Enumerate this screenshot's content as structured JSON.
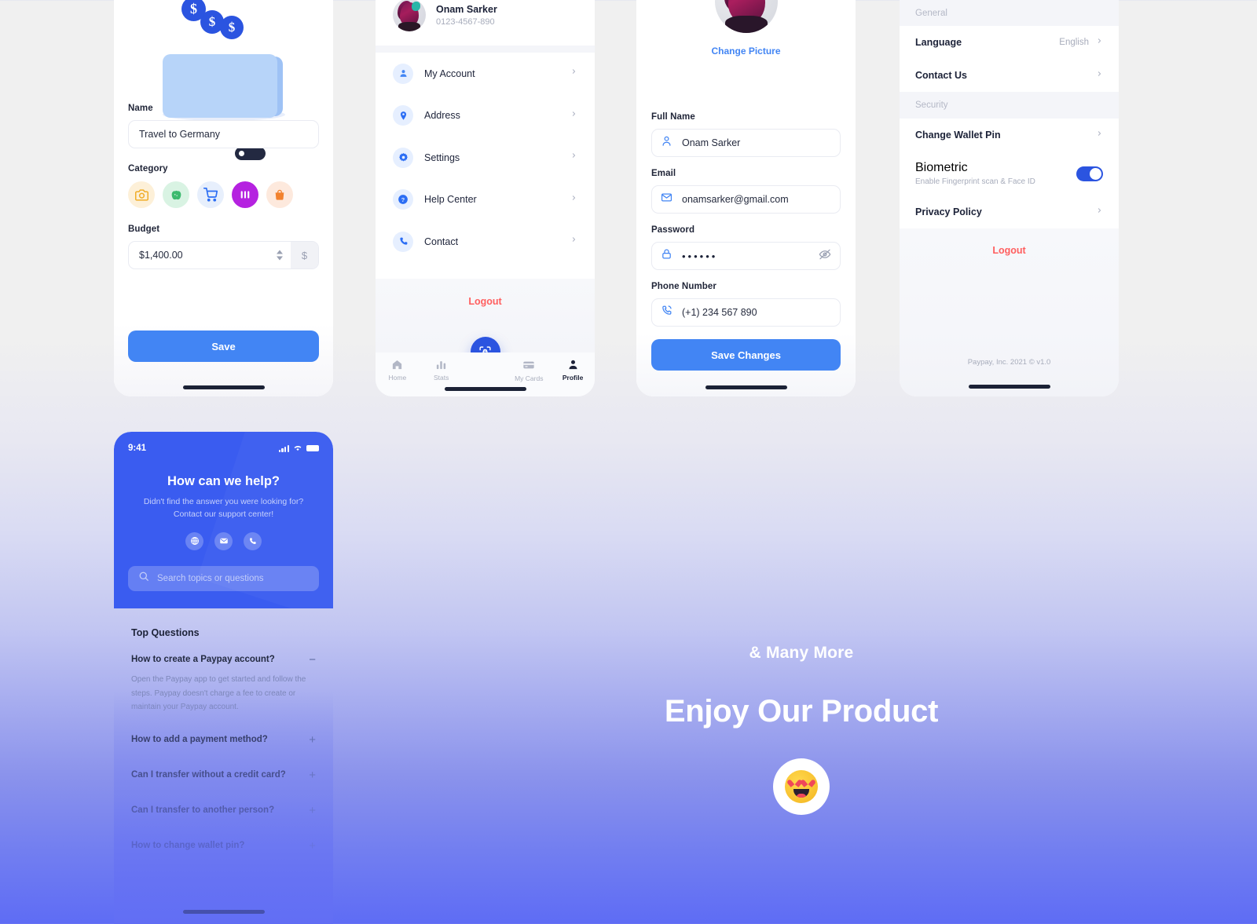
{
  "screens": {
    "add_budget": {
      "fields": {
        "name_label": "Name",
        "name_value": "Travel to Germany",
        "category_label": "Category",
        "budget_label": "Budget",
        "budget_value": "$1,400.00",
        "currency_symbol": "$"
      },
      "categories": [
        {
          "name": "camera-icon",
          "color": "#FDF0D8"
        },
        {
          "name": "food-icon",
          "color": "#D9F3E3"
        },
        {
          "name": "cart-icon",
          "color": "#E7EFFC"
        },
        {
          "name": "music-icon",
          "color": "#B522E0"
        },
        {
          "name": "bag-icon",
          "color": "#FDE9DD"
        }
      ],
      "save_label": "Save"
    },
    "profile_menu": {
      "user_name": "Onam Sarker",
      "user_phone": "0123-4567-890",
      "items": [
        {
          "label": "My Account",
          "icon": "person-icon"
        },
        {
          "label": "Address",
          "icon": "location-pin-icon"
        },
        {
          "label": "Settings",
          "icon": "gear-icon"
        },
        {
          "label": "Help Center",
          "icon": "question-mark-icon"
        },
        {
          "label": "Contact",
          "icon": "phone-icon"
        }
      ],
      "logout_label": "Logout",
      "tabs": [
        {
          "label": "Home",
          "icon": "home-icon",
          "active": false
        },
        {
          "label": "Stats",
          "icon": "bar-chart-icon",
          "active": false
        },
        {
          "label": "My Cards",
          "icon": "credit-card-icon",
          "active": false
        },
        {
          "label": "Profile",
          "icon": "person-icon",
          "active": true
        }
      ],
      "fab_icon": "scan-icon"
    },
    "edit_profile": {
      "change_picture_label": "Change Picture",
      "fields": [
        {
          "label": "Full Name",
          "value": "Onam Sarker",
          "icon": "person-icon"
        },
        {
          "label": "Email",
          "value": "onamsarker@gmail.com",
          "icon": "mail-icon"
        },
        {
          "label": "Password",
          "value": "••••••",
          "icon": "lock-icon",
          "trailing_icon": "eye-off-icon"
        },
        {
          "label": "Phone Number",
          "value": "(+1) 234 567 890",
          "icon": "phone-call-icon"
        }
      ],
      "save_label": "Save Changes"
    },
    "settings": {
      "section_general": "General",
      "general_rows": [
        {
          "label": "Language",
          "value": "English"
        },
        {
          "label": "Contact Us",
          "value": ""
        }
      ],
      "section_security": "Security",
      "security_rows": [
        {
          "label": "Change Wallet Pin"
        },
        {
          "label": "Biometric",
          "sub": "Enable Fingerprint scan & Face ID",
          "toggle": "on"
        },
        {
          "label": "Privacy Policy"
        }
      ],
      "logout_label": "Logout",
      "copyright": "Paypay, Inc. 2021 © v1.0"
    },
    "help_center": {
      "status_time": "9:41",
      "title": "How can we help?",
      "subtitle_line1": "Didn't find the answer you were looking for?",
      "subtitle_line2": "Contact our support center!",
      "contact_icons": [
        "globe-icon",
        "mail-icon",
        "phone-icon"
      ],
      "search_placeholder": "Search topics or questions",
      "top_questions_label": "Top Questions",
      "faqs": [
        {
          "question": "How to create a Paypay account?",
          "toggle": "−",
          "answer": "Open the Paypay app to get started and follow the steps. Paypay doesn't charge a fee to create or maintain your Paypay account."
        },
        {
          "question": "How to add a payment method?",
          "toggle": "+",
          "answer": ""
        },
        {
          "question": "Can I transfer without a credit card?",
          "toggle": "+",
          "answer": ""
        },
        {
          "question": "Can I transfer to another person?",
          "toggle": "+",
          "answer": ""
        },
        {
          "question": "How to change wallet pin?",
          "toggle": "+",
          "answer": ""
        }
      ]
    }
  },
  "hero": {
    "small_title": "& Many More",
    "big_title": "Enjoy Our Product",
    "emoji": "heart-eyes-emoji"
  },
  "colors": {
    "primary_blue": "#4285F4",
    "deep_blue": "#2B54E0",
    "hero_blue": "#3A5CF0",
    "logout_red": "#FF5F5F",
    "music_purple": "#B522E0"
  }
}
